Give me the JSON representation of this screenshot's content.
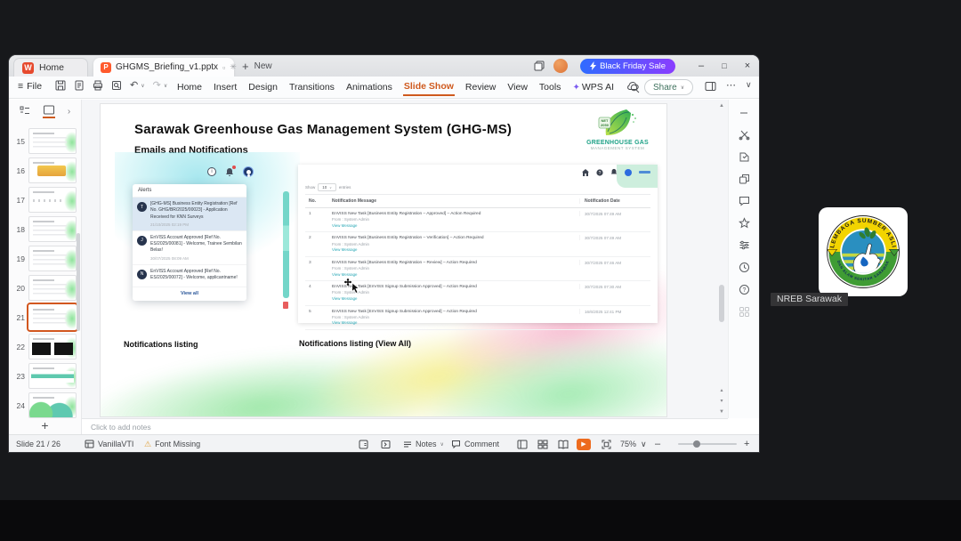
{
  "window_title": {
    "home_tab": "Home",
    "doc_tab": "GHGMS_Briefing_v1.pptx",
    "new_tab": "New",
    "promo": "Black Friday Sale"
  },
  "menubar": {
    "file": "File",
    "items": [
      "Home",
      "Insert",
      "Design",
      "Transitions",
      "Animations",
      "Slide Show",
      "Review",
      "View",
      "Tools",
      "WPS AI"
    ],
    "active": "Slide Show",
    "share": "Share"
  },
  "thumbnails": {
    "items": [
      {
        "n": "15",
        "variant": "table",
        "selected": false
      },
      {
        "n": "16",
        "variant": "banner",
        "selected": false
      },
      {
        "n": "17",
        "variant": "dots",
        "selected": false
      },
      {
        "n": "18",
        "variant": "table",
        "selected": false
      },
      {
        "n": "19",
        "variant": "table",
        "selected": false
      },
      {
        "n": "20",
        "variant": "table",
        "selected": false
      },
      {
        "n": "21",
        "variant": "table",
        "selected": true
      },
      {
        "n": "22",
        "variant": "dark",
        "selected": false
      },
      {
        "n": "23",
        "variant": "band",
        "selected": false
      },
      {
        "n": "24",
        "variant": "blobs",
        "selected": false
      }
    ]
  },
  "slide": {
    "title": "Sarawak Greenhouse Gas Management System (GHG-MS)",
    "subtitle": "Emails and Notifications",
    "logo": {
      "badge": "NET 2050",
      "line1": "GREENHOUSE GAS",
      "line2": "MANAGEMENT SYSTEM"
    },
    "alerts_panel": {
      "title": "Alerts",
      "view_all": "View all",
      "items": [
        {
          "avatar": "T",
          "text": "[GHG-MS] Business Entity Registration [Ref No. GHG/BR/2025/00023] - Application Received for KNN Surveys",
          "date": "21/10/2025 02:19 PM",
          "highlight": true
        },
        {
          "avatar": "J",
          "text": "EnVISS Account Approved [Ref No. ES/2025/00081] - Welcome, Trainee Sembilan Belas!",
          "date": "30/07/2025 08:09 AM",
          "highlight": false
        },
        {
          "avatar": "N",
          "text": "EnVISS Account Approved [Ref No. ES/2025/00072] - Welcome, applicantname!",
          "date": "",
          "highlight": false
        }
      ]
    },
    "table_panel": {
      "show_label": "Show",
      "show_value": "10",
      "entries_label": "entries",
      "columns": [
        "No.",
        "Notification Message",
        "Notification Date"
      ],
      "rows": [
        {
          "no": "1",
          "message": "EnVISS New Task [Business Entity Registration – Approved] – Action Required",
          "from": "From : System Admin",
          "link": "View Message",
          "date": "30/7/2025 07:49 AM"
        },
        {
          "no": "2",
          "message": "EnVISS New Task [Business Entity Registration – Verification] – Action Required",
          "from": "From : System Admin",
          "link": "View Message",
          "date": "30/7/2025 07:49 AM"
        },
        {
          "no": "3",
          "message": "EnVISS New Task [Business Entity Registration – Review] – Action Required",
          "from": "From : System Admin",
          "link": "View Message",
          "date": "30/7/2025 07:46 AM"
        },
        {
          "no": "4",
          "message": "EnVISS New Task [EnVISS Signup Submission Approved] – Action Required",
          "from": "From : System Admin",
          "link": "View Message",
          "date": "30/7/2025 07:30 AM"
        },
        {
          "no": "5",
          "message": "EnVISS New Task [EnVISS Signup Submission Approved] – Action Required",
          "from": "From : System Admin",
          "link": "View Message",
          "date": "16/6/2025 12:41 PM"
        }
      ]
    },
    "captions": {
      "left": "Notifications listing",
      "right": "Notifications listing (View All)"
    }
  },
  "notes": {
    "placeholder": "Click to add notes"
  },
  "statusbar": {
    "slide_counter": "Slide 21 / 26",
    "theme_name": "VanillaVTI",
    "font_missing": "Font Missing",
    "notes_label": "Notes",
    "comment_label": "Comment",
    "zoom_level": "75%"
  },
  "meeting": {
    "participant_name": "NREB Sarawak",
    "logo_arc_top": "LEMBAGA SUMBER ASLI",
    "logo_arc_bottom": "DAN ALAM SEKITAR SARAWAK"
  },
  "colors": {
    "accent_orange": "#d2571f",
    "promo_blue": "#2f6bff",
    "promo_purple": "#8a3dff",
    "highlight_row": "#dbe7f3",
    "link_teal": "#27a7b5"
  },
  "icons": {
    "menu": "≡",
    "undo": "↶",
    "redo": "↷",
    "chevron_down": "∨",
    "chevron_right": "›",
    "chevron_up": "∧",
    "more": "⋯",
    "minimize": "–",
    "maximize": "□",
    "close": "×",
    "plus": "+",
    "warning": "⚠",
    "play": "▶",
    "scroll_up": "▲",
    "scroll_down": "▼",
    "prev": "▴",
    "next": "▾"
  }
}
